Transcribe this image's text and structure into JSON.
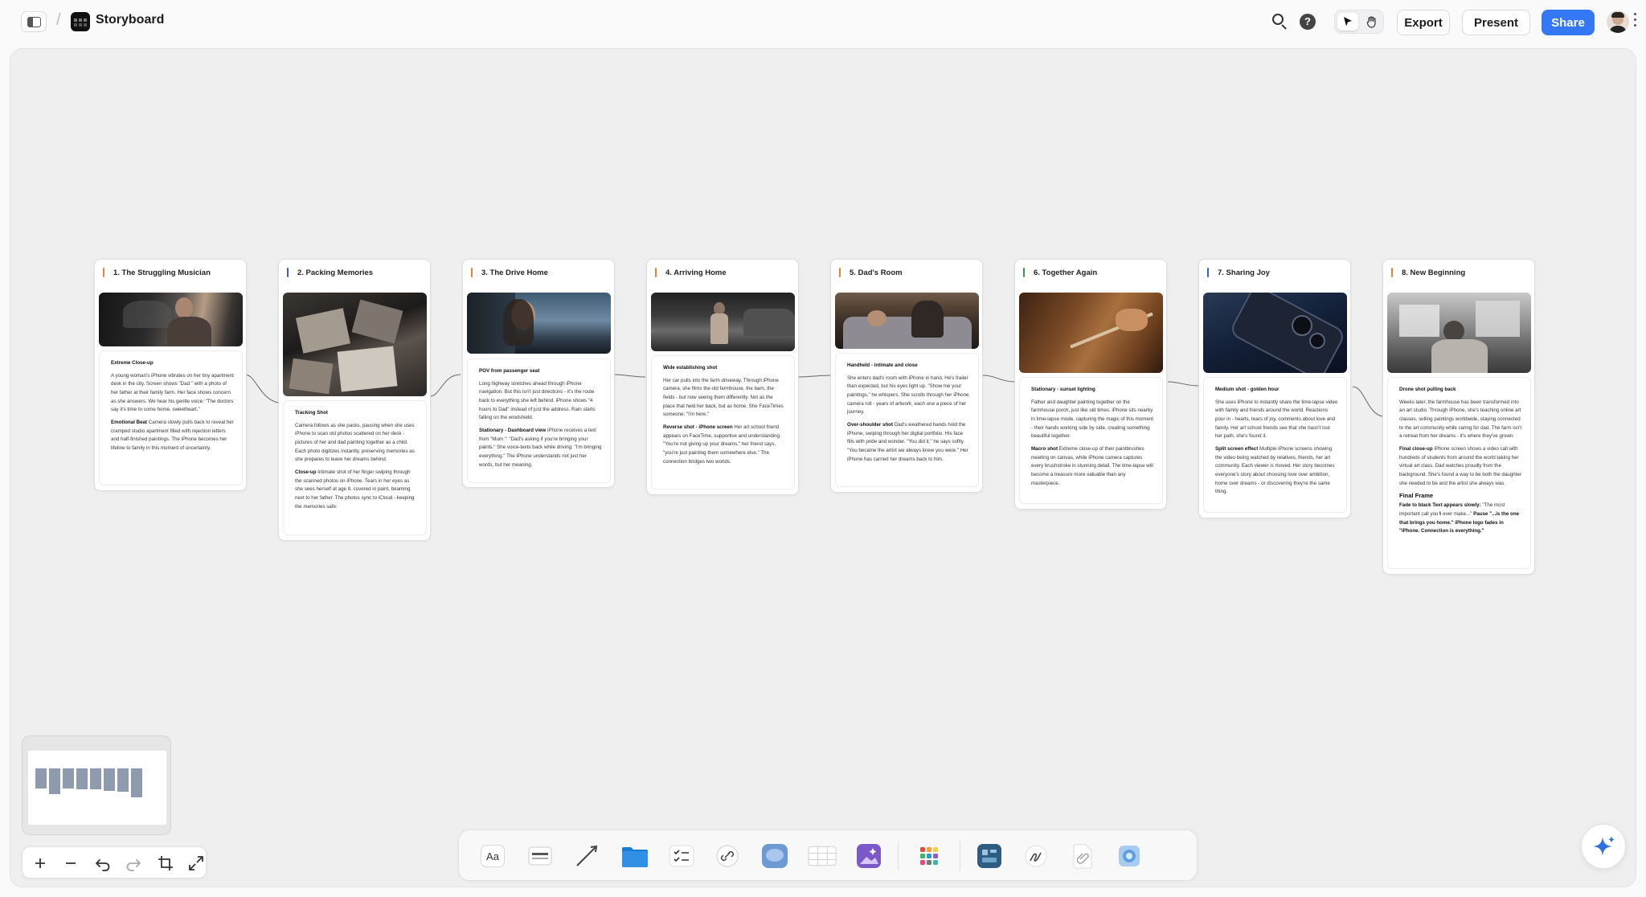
{
  "topbar": {
    "breadcrumb_sep": "/",
    "title": "Storyboard",
    "help": "?",
    "export_label": "Export",
    "present_label": "Present",
    "share_label": "Share",
    "share_color": "#3478f6"
  },
  "cards": [
    {
      "title": "1. The Struggling Musician",
      "accent": "#e8833a",
      "image": "woman on phone in car at night",
      "body": [
        {
          "head": "Extreme Close-up",
          "text": ""
        },
        {
          "head": "",
          "text": "A young woman's iPhone vibrates on her tiny apartment desk in the city. Screen shows \"Dad \" with a photo of her father at their family farm. Her face shows concern as she answers. We hear his gentle voice: \"The doctors say it's time to come home, sweetheart.\""
        },
        {
          "head": "Emotional Beat",
          "text": "Camera slowly pulls back to reveal her cramped studio apartment filled with rejection letters and half-finished paintings. The iPhone becomes her lifeline to family in this moment of uncertainty."
        }
      ]
    },
    {
      "title": "2. Packing Memories",
      "accent": "#3b5bdb",
      "image": "old photos on a desk",
      "body": [
        {
          "head": "Tracking Shot",
          "text": ""
        },
        {
          "head": "",
          "text": "Camera follows as she packs, pausing when she uses iPhone to scan old photos scattered on her desk - pictures of her and dad painting together as a child. Each photo digitizes instantly, preserving memories as she prepares to leave her dreams behind."
        },
        {
          "head": "Close-up",
          "text": "Intimate shot of her finger swiping through the scanned photos on iPhone. Tears in her eyes as she sees herself at age 8, covered in paint, beaming next to her father. The photos sync to iCloud - keeping the memories safe."
        }
      ]
    },
    {
      "title": "3. The Drive Home",
      "accent": "#e8833a",
      "image": "woman driving at dusk",
      "body": [
        {
          "head": "POV from passenger seat",
          "text": ""
        },
        {
          "head": "",
          "text": "Long highway stretches ahead through iPhone navigation. But this isn't just directions - it's the route back to everything she left behind. iPhone shows \"4 hours to Dad\" instead of just the address. Rain starts falling on the windshield."
        },
        {
          "head": "Stationary - Dashboard view",
          "text": "iPhone receives a text from \"Mum \": \"Dad's asking if you're bringing your paints.\" She voice-texts back while driving: \"I'm bringing everything.\" The iPhone understands not just her words, but her meaning."
        }
      ]
    },
    {
      "title": "4. Arriving Home",
      "accent": "#e8833a",
      "image": "woman walking to farmhouse at night",
      "body": [
        {
          "head": "Wide establishing shot",
          "text": ""
        },
        {
          "head": "",
          "text": "Her car pulls into the farm driveway. Through iPhone camera, she films the old farmhouse, the barn, the fields - but now seeing them differently. Not as the place that held her back, but as home. She FaceTimes someone: \"I'm here.\""
        },
        {
          "head": "Reverse shot - iPhone screen",
          "text": "Her art school friend appears on FaceTime, supportive and understanding. \"You're not giving up your dreams,\" her friend says, \"you're just painting them somewhere else.\" The connection bridges two worlds."
        }
      ]
    },
    {
      "title": "5. Dad's Room",
      "accent": "#e8833a",
      "image": "father resting in bed",
      "body": [
        {
          "head": "Handheld - intimate and close",
          "text": ""
        },
        {
          "head": "",
          "text": "She enters dad's room with iPhone in hand. He's frailer than expected, but his eyes light up. \"Show me your paintings,\" he whispers. She scrolls through her iPhone camera roll - years of artwork, each one a piece of her journey."
        },
        {
          "head": "Over-shoulder shot",
          "text": "Dad's weathered hands hold the iPhone, swiping through her digital portfolio. His face fills with pride and wonder. \"You did it,\" he says softly. \"You became the artist we always knew you were.\" Her iPhone has carried her dreams back to him."
        }
      ]
    },
    {
      "title": "6. Together Again",
      "accent": "#2f9e44",
      "image": "hand holding paintbrush at sunset",
      "body": [
        {
          "head": "Stationary - sunset lighting",
          "text": ""
        },
        {
          "head": "",
          "text": "Father and daughter painting together on the farmhouse porch, just like old times. iPhone sits nearby in time-lapse mode, capturing the magic of this moment - their hands working side by side, creating something beautiful together."
        },
        {
          "head": "Macro shot",
          "text": "Extreme close-up of their paintbrushes meeting on canvas, while iPhone camera captures every brushstroke in stunning detail. The time-lapse will become a treasure more valuable than any masterpiece."
        }
      ]
    },
    {
      "title": "7. Sharing Joy",
      "accent": "#3b5bdb",
      "image": "iPhone camera close-up",
      "body": [
        {
          "head": "Medium shot - golden hour",
          "text": ""
        },
        {
          "head": "",
          "text": "She uses iPhone to instantly share the time-lapse video with family and friends around the world. Reactions pour in - hearts, tears of joy, comments about love and family. Her art school friends see that she hasn't lost her path, she's found it."
        },
        {
          "head": "Split screen effect",
          "text": "Multiple iPhone screens showing the video being watched by relatives, friends, her art community. Each viewer is moved. Her story becomes everyone's story about choosing love over ambition, home over dreams - or discovering they're the same thing."
        }
      ]
    },
    {
      "title": "8. New Beginning",
      "accent": "#e8833a",
      "image": "art studio in farmhouse",
      "body": [
        {
          "head": "Drone shot pulling back",
          "text": ""
        },
        {
          "head": "",
          "text": "Weeks later, the farmhouse has been transformed into an art studio. Through iPhone, she's teaching online art classes, selling paintings worldwide, staying connected to the art community while caring for dad. The farm isn't a retreat from her dreams - it's where they've grown."
        },
        {
          "head": "Final close-up",
          "text": "iPhone screen shows a video call with hundreds of students from around the world taking her virtual art class. Dad watches proudly from the background. She's found a way to be both the daughter she needed to be and the artist she always was."
        },
        {
          "frame": "Final Frame"
        },
        {
          "head": "Fade to black Text appears slowly:",
          "text": "\"The most important call you'll ever make...\"",
          "bold_tail": "Pause \"...is the one that brings you home.\" iPhone logo fades in \"iPhone. Connection is everything.\""
        }
      ]
    }
  ],
  "minimap": {
    "cards": 8
  },
  "zoom_controls": [
    "zoom-in",
    "zoom-out",
    "undo",
    "redo",
    "fit-frame",
    "fullscreen"
  ],
  "dock": {
    "text_tool_label": "Aa",
    "tools": [
      "text-icon",
      "card-icon",
      "line-icon",
      "folder-icon",
      "checklist-icon",
      "link-icon",
      "comment-icon",
      "table-icon",
      "image-icon",
      "apps-icon",
      "board-icon",
      "sketch-icon",
      "file-icon",
      "photos-icon"
    ]
  }
}
